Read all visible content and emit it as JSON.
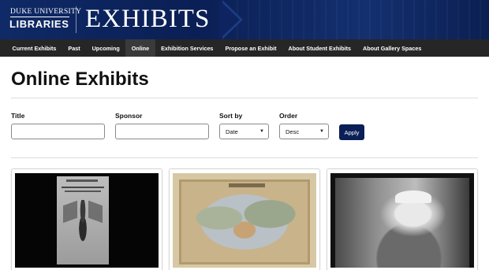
{
  "header": {
    "org_top": "DUKE UNIVERSITY",
    "org_bottom": "LIBRARIES",
    "site_title": "EXHIBITS"
  },
  "nav": {
    "items": [
      {
        "label": "Current Exhibits",
        "active": false
      },
      {
        "label": "Past",
        "active": false
      },
      {
        "label": "Upcoming",
        "active": false
      },
      {
        "label": "Online",
        "active": true
      },
      {
        "label": "Exhibition Services",
        "active": false
      },
      {
        "label": "Propose an Exhibit",
        "active": false
      },
      {
        "label": "About Student Exhibits",
        "active": false
      },
      {
        "label": "About Gallery Spaces",
        "active": false
      }
    ]
  },
  "page": {
    "title": "Online Exhibits"
  },
  "filters": {
    "title_label": "Title",
    "title_value": "",
    "sponsor_label": "Sponsor",
    "sponsor_value": "",
    "sort_label": "Sort by",
    "sort_value": "Date",
    "order_label": "Order",
    "order_value": "Desc",
    "apply_label": "Apply"
  },
  "cards": [
    {
      "image": "winged-figure-engraving"
    },
    {
      "image": "antique-world-map"
    },
    {
      "image": "portrait-photo"
    }
  ],
  "colors": {
    "brand_navy": "#0a1f55",
    "nav_bg": "#262626"
  }
}
